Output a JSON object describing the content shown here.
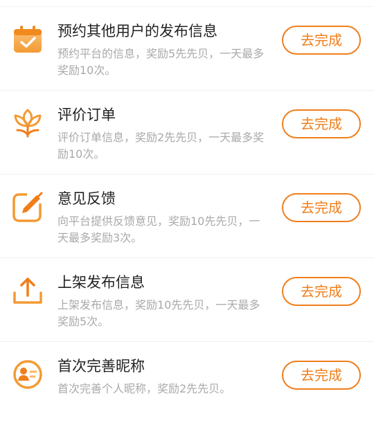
{
  "tasks": [
    {
      "icon": "calendar-check-icon",
      "title": "预约其他用户的发布信息",
      "desc": "预约平台的信息，奖励5先先贝，一天最多奖励10次。",
      "button": "去完成"
    },
    {
      "icon": "flower-icon",
      "title": "评价订单",
      "desc": "评价订单信息，奖励2先先贝，一天最多奖励10次。",
      "button": "去完成"
    },
    {
      "icon": "edit-pencil-icon",
      "title": "意见反馈",
      "desc": "向平台提供反馈意见，奖励10先先贝，一天最多奖励3次。",
      "button": "去完成"
    },
    {
      "icon": "upload-icon",
      "title": "上架发布信息",
      "desc": "上架发布信息，奖励10先先贝，一天最多奖励5次。",
      "button": "去完成"
    },
    {
      "icon": "profile-card-icon",
      "title": "首次完善昵称",
      "desc": "首次完善个人昵称，奖励2先先贝。",
      "button": "去完成"
    }
  ],
  "colors": {
    "accent": "#f07e1a",
    "icon_light": "#fbb765",
    "title": "#222222",
    "desc": "#a9a9a9"
  }
}
